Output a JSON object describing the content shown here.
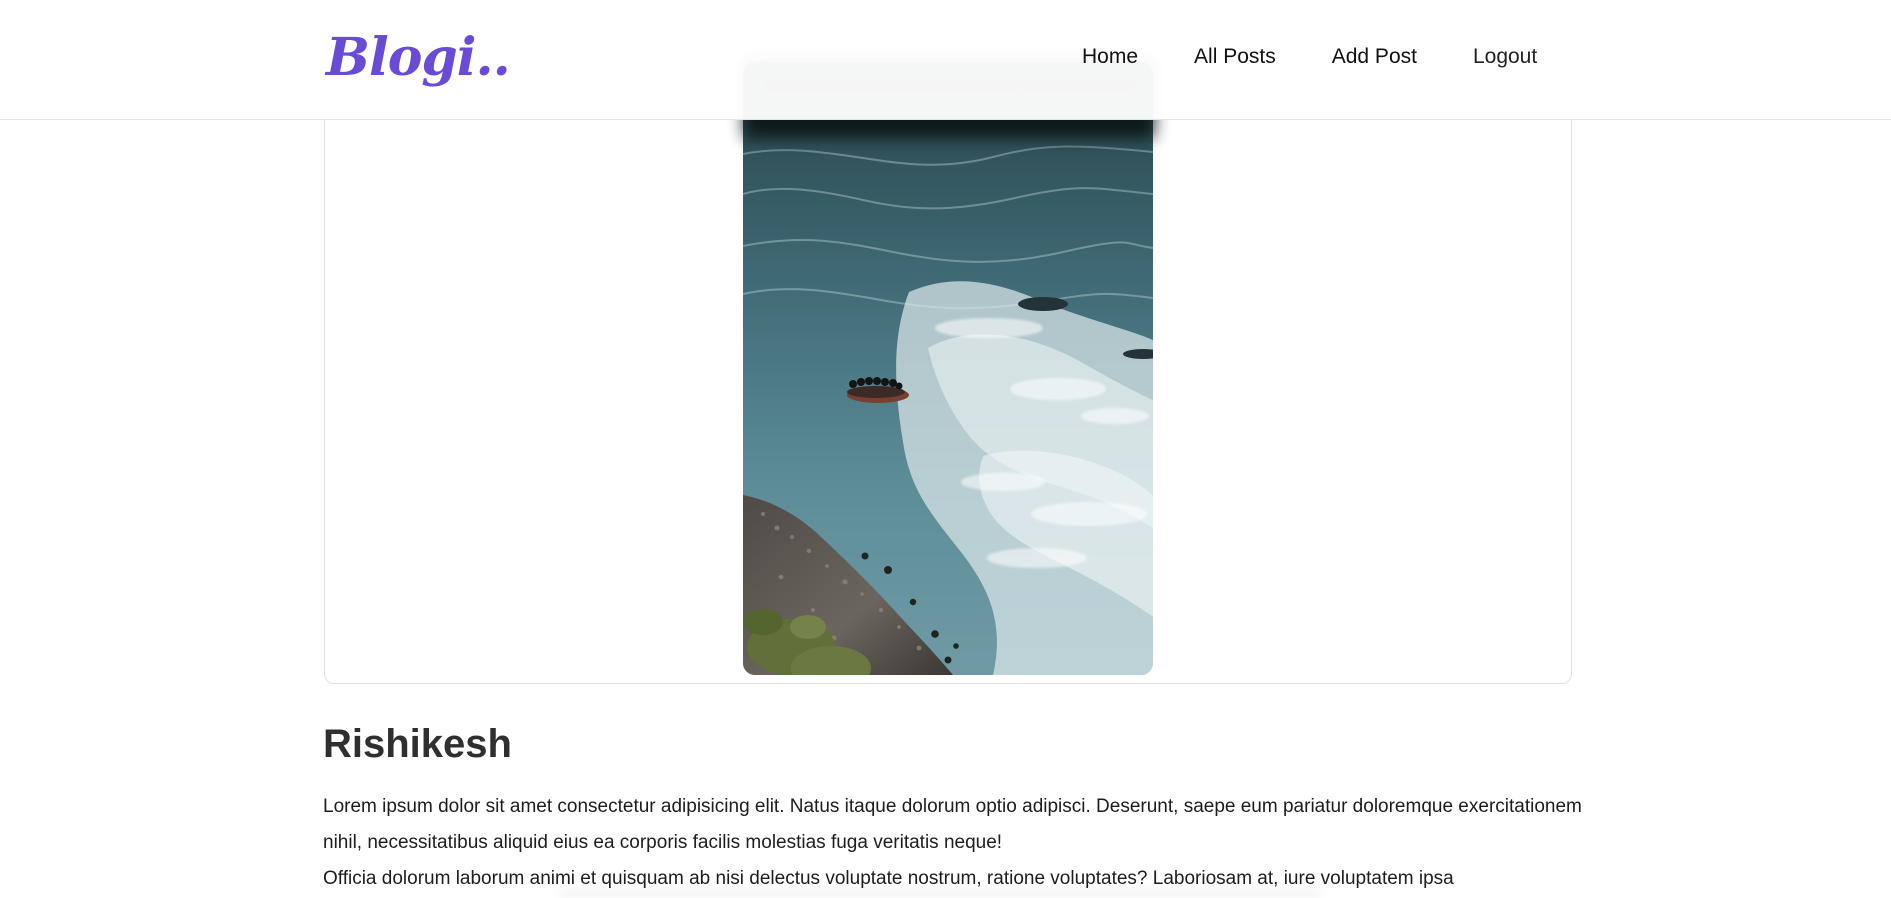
{
  "brand": {
    "logo_text": "Blogi..",
    "accent": "#6a4bd6"
  },
  "nav": {
    "home": "Home",
    "all_posts": "All Posts",
    "add_post": "Add Post",
    "logout": "Logout"
  },
  "post": {
    "title": "Rishikesh",
    "paragraphs": [
      "Lorem ipsum dolor sit amet consectetur adipisicing elit. Natus itaque dolorum optio adipisci. Deserunt, saepe eum pariatur doloremque exercitationem nihil, necessitatibus aliquid eius ea corporis facilis molestias fuga veritatis neque!",
      "Officia dolorum laborum animi et quisquam ab nisi delectus voluptate nostrum, ratione voluptates? Laboriosam at, iure voluptatem ipsa"
    ]
  }
}
